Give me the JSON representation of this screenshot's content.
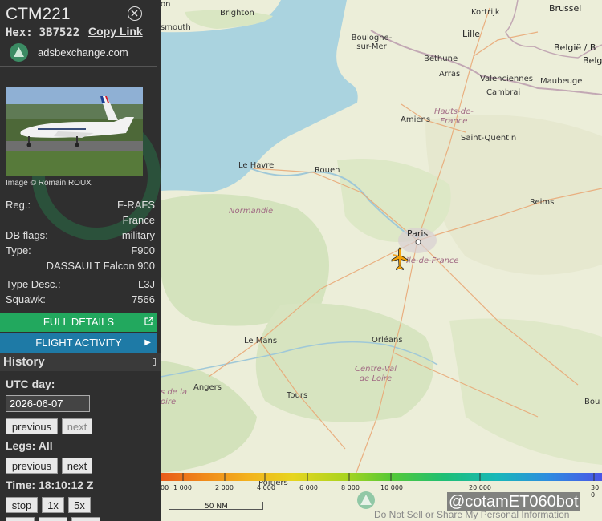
{
  "aircraft": {
    "callsign": "CTM221",
    "hex_label": "Hex:",
    "hex": "3B7522",
    "copy_link": "Copy Link",
    "site": "adsbexchange.com",
    "photo_credit": "Image © Romain ROUX",
    "info": [
      {
        "label": "Reg.:",
        "value": "F-RAFS"
      },
      {
        "label": "",
        "value": "France"
      },
      {
        "label": "DB flags:",
        "value": "military"
      },
      {
        "label": "Type:",
        "value": "F900"
      },
      {
        "label": "",
        "value": "DASSAULT Falcon 900"
      },
      {
        "label": "Type Desc.:",
        "value": "L3J"
      },
      {
        "label": "Squawk:",
        "value": "7566"
      }
    ]
  },
  "buttons": {
    "full_details": "FULL DETAILS",
    "flight_activity": "FLIGHT ACTIVITY"
  },
  "history": {
    "title": "History",
    "utc_day_label": "UTC day:",
    "date_value": "2026-06-07",
    "prev": "previous",
    "next": "next",
    "legs_label": "Legs: All",
    "time_label": "Time: 18:10:12 Z",
    "stop": "stop",
    "speed_1x": "1x",
    "speed_5x": "5x"
  },
  "map": {
    "places": [
      {
        "name": "Brighton",
        "big": false
      },
      {
        "name": "smouth",
        "big": false
      },
      {
        "name": "on",
        "big": false
      },
      {
        "name": "Brussel",
        "big": true
      },
      {
        "name": "Kortrijk",
        "big": false
      },
      {
        "name": "Lille",
        "big": true
      },
      {
        "name": "Boulogne-\nsur-Mer",
        "big": false
      },
      {
        "name": "België / B",
        "big": true
      },
      {
        "name": "Belg",
        "big": true
      },
      {
        "name": "Béthune",
        "big": false
      },
      {
        "name": "Arras",
        "big": false
      },
      {
        "name": "Valenciennes",
        "big": false
      },
      {
        "name": "Maubeuge",
        "big": false
      },
      {
        "name": "Cambrai",
        "big": false
      },
      {
        "name": "Amiens",
        "big": false
      },
      {
        "name": "Saint-Quentin",
        "big": false
      },
      {
        "name": "Le Havre",
        "big": false
      },
      {
        "name": "Rouen",
        "big": false
      },
      {
        "name": "Reims",
        "big": false
      },
      {
        "name": "Paris",
        "big": true
      },
      {
        "name": "Le Mans",
        "big": false
      },
      {
        "name": "Orléans",
        "big": false
      },
      {
        "name": "Angers",
        "big": false
      },
      {
        "name": "Tours",
        "big": false
      },
      {
        "name": "Poitiers",
        "big": false
      },
      {
        "name": "Bou",
        "big": false
      }
    ],
    "regions": [
      "Hauts-de-\nFrance",
      "Normandie",
      "Île-de-France",
      "Centre-Val\nde Loire",
      "s de la\noire"
    ],
    "colorbar_labels": [
      "00",
      "1 000",
      "2 000",
      "4 000",
      "6 000",
      "8 000",
      "10 000",
      "20 000",
      "30 0"
    ],
    "colorbar_colors": [
      "#e85b1a",
      "#f08a1a",
      "#f3b21d",
      "#e7d51f",
      "#a9d41f",
      "#57c936",
      "#1fbf73",
      "#18b8b8",
      "#2e8be0",
      "#4a55e6"
    ],
    "scale_label": "50 NM",
    "bot_label": "@cotamET060bot",
    "dns_link": "Do Not Sell or Share My Personal Information"
  }
}
